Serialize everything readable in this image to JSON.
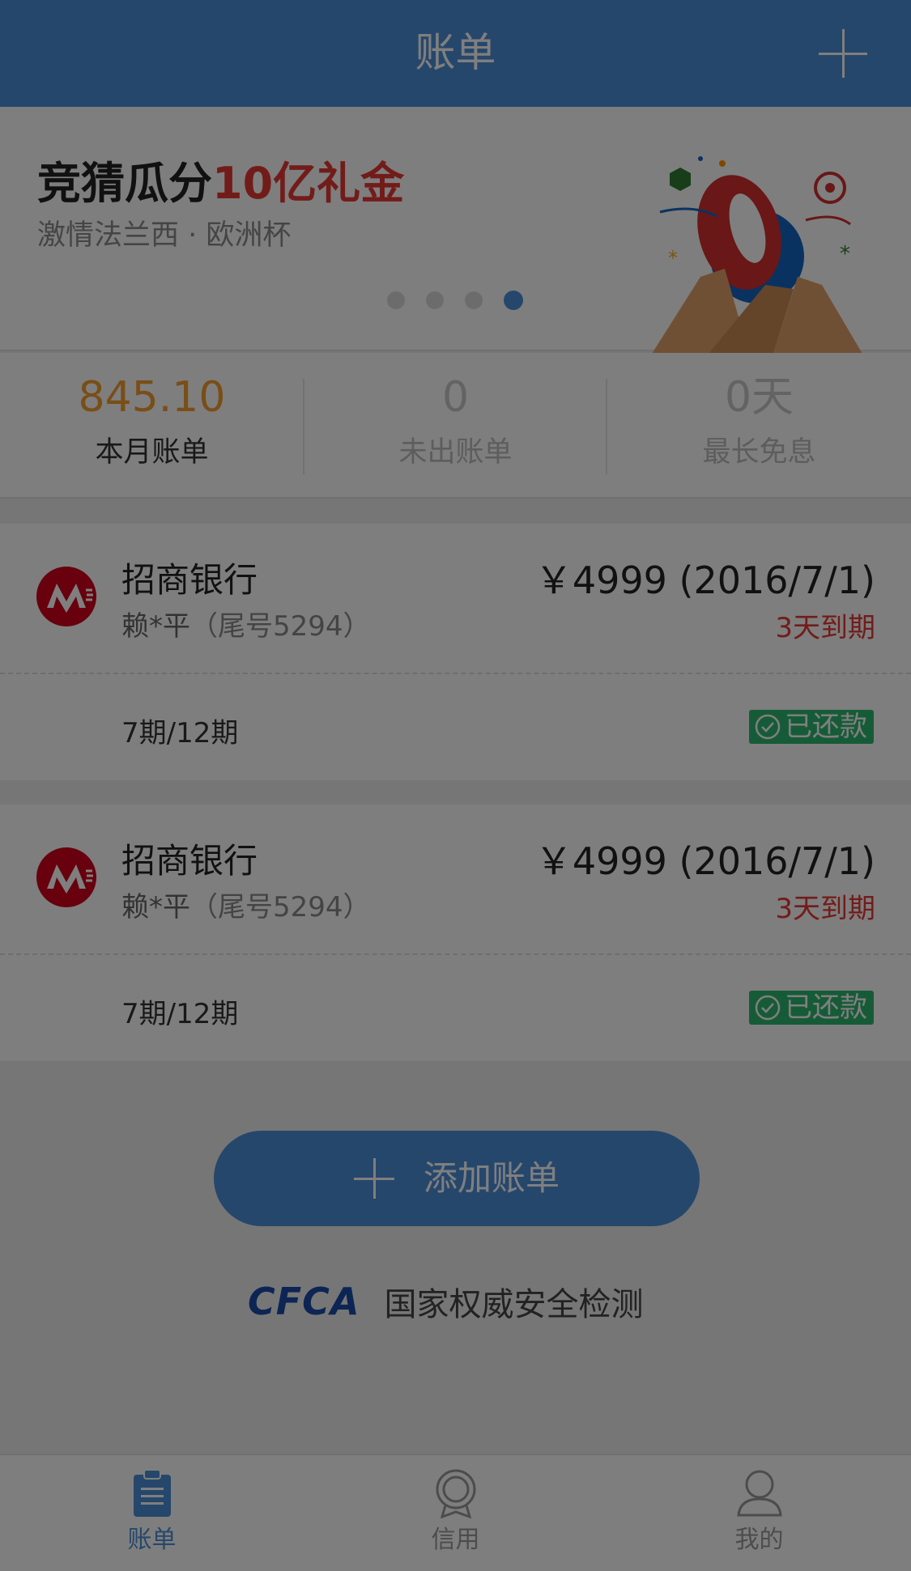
{
  "header": {
    "title": "账单",
    "add_icon": "plus-icon"
  },
  "banner": {
    "headline_prefix": "竞猜瓜分",
    "headline_accent": "10亿礼金",
    "subtitle": "激情法兰西 · 欧洲杯",
    "dots_count": 4,
    "active_dot": 4
  },
  "stats": [
    {
      "value": "845.10",
      "label": "本月账单"
    },
    {
      "value": "0",
      "label": "未出账单"
    },
    {
      "value": "0天",
      "label": "最长免息"
    }
  ],
  "bills": [
    {
      "bank": "招商银行",
      "holder": "赖*平",
      "tail": "（尾号5294）",
      "amount": "￥4999 (2016/7/1)",
      "due": "3天到期",
      "period": "7期/12期",
      "status": "已还款"
    },
    {
      "bank": "招商银行",
      "holder": "赖*平",
      "tail": "（尾号5294）",
      "amount": "￥4999 (2016/7/1)",
      "due": "3天到期",
      "period": "7期/12期",
      "status": "已还款"
    }
  ],
  "add_button": {
    "label": "添加账单"
  },
  "cfca": {
    "logo": "CFCA",
    "text": "国家权威安全检测"
  },
  "tabs": [
    {
      "label": "账单",
      "icon": "clipboard-icon",
      "active": true
    },
    {
      "label": "信用",
      "icon": "badge-icon",
      "active": false
    },
    {
      "label": "我的",
      "icon": "person-icon",
      "active": false
    }
  ],
  "colors": {
    "primary": "#4d8ed9",
    "accent_red": "#e53935",
    "amount_orange": "#f39c2e",
    "paid_green": "#2db76e",
    "cfca_blue": "#1b4ba8"
  }
}
